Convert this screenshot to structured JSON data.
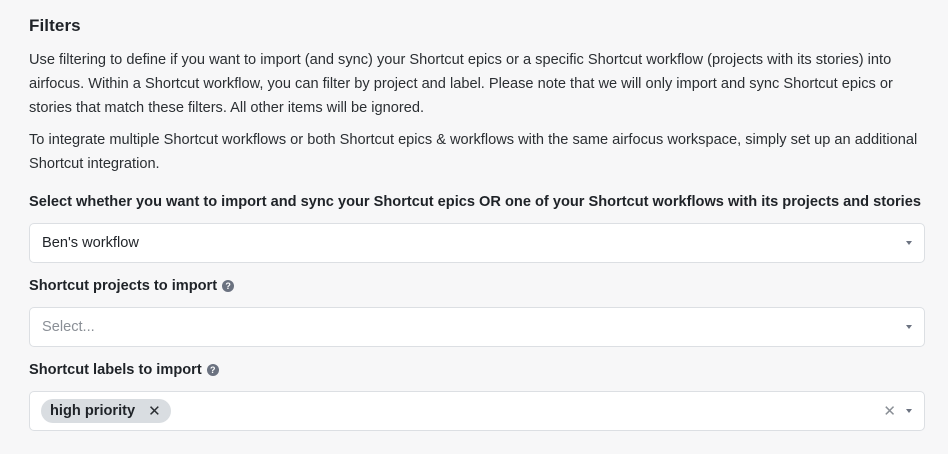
{
  "section": {
    "title": "Filters",
    "description_1": "Use filtering to define if you want to import (and sync) your Shortcut epics or a specific Shortcut workflow (projects with its stories) into airfocus. Within a Shortcut workflow, you can filter by project and label. Please note that we will only import and sync Shortcut epics or stories that match these filters. All other items will be ignored.",
    "description_2": "To integrate multiple Shortcut workflows or both Shortcut epics & workflows with the same airfocus workspace, simply set up an additional Shortcut integration."
  },
  "fields": {
    "source": {
      "label": "Select whether you want to import and sync your Shortcut epics OR one of your Shortcut workflows with its projects and stories",
      "value": "Ben's workflow"
    },
    "projects": {
      "label": "Shortcut projects to import",
      "placeholder": "Select..."
    },
    "labels": {
      "label": "Shortcut labels to import",
      "tags": [
        "high priority"
      ]
    }
  },
  "icons": {
    "help": "question-mark-circle-icon",
    "caret": "chevron-down-icon",
    "clear": "close-icon",
    "tag_remove": "close-icon"
  },
  "colors": {
    "background": "#f7f7f8",
    "tag_background": "#d9dde1",
    "border": "#dcdfe3"
  }
}
